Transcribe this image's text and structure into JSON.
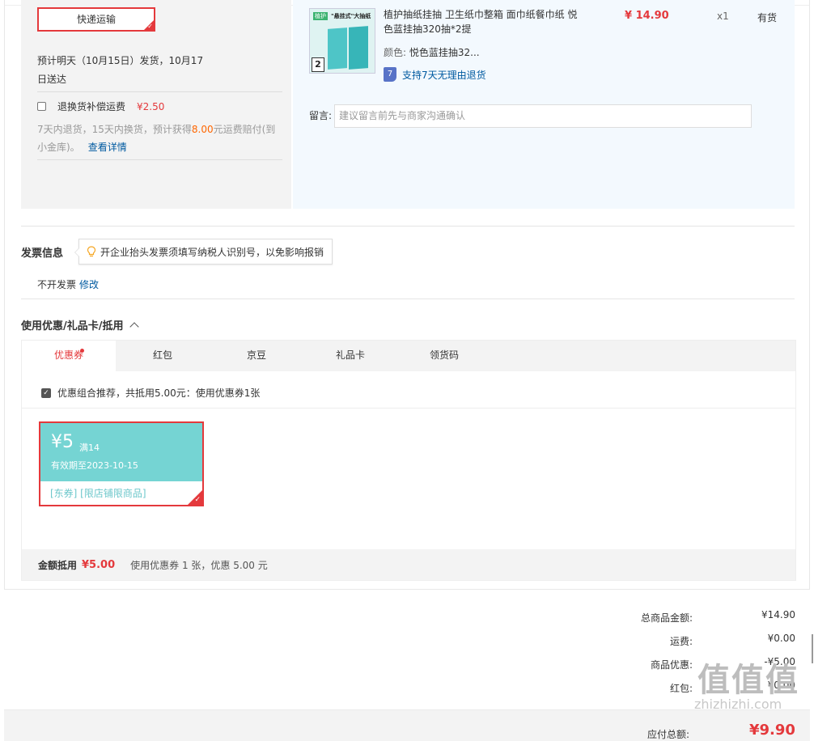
{
  "shipping": {
    "method_label": "快递运输",
    "eta": "预计明天（10月15日）发货，10月17日送达",
    "refund_label": "退换货补偿运费",
    "refund_price": "¥2.50",
    "refund_note_a": "7天内退货，15天内换货，预计获得",
    "refund_note_amount": "8.00",
    "refund_note_b": "元运费赔付(到小金库)。",
    "refund_link": "查看详情"
  },
  "product": {
    "title": "植护抽纸挂抽 卫生纸巾整箱 面巾纸餐巾纸 悦色蓝挂抽320抽*2提",
    "color_label": "颜色:",
    "color_value": "悦色蓝挂抽32...",
    "return_badge": "7",
    "return_text": "支持7天无理由退货",
    "price": "¥ 14.90",
    "qty": "x1",
    "stock": "有货",
    "image_tag": "植护",
    "image_head": "\"悬挂式\"大抽纸",
    "image_count": "2"
  },
  "message": {
    "label": "留言:",
    "placeholder": "建议留言前先与商家沟通确认"
  },
  "invoice": {
    "title": "发票信息",
    "tip": "开企业抬头发票须填写纳税人识别号，以免影响报销",
    "value": "不开发票",
    "edit_link": "修改"
  },
  "coupons": {
    "title": "使用优惠/礼品卡/抵用",
    "tabs": [
      "优惠券",
      "红包",
      "京豆",
      "礼品卡",
      "领货码"
    ],
    "combo_text": "优惠组合推荐，共抵用5.00元：使用优惠券1张",
    "card": {
      "amount": "¥5",
      "condition": "满14",
      "expiry": "有效期至2023-10-15",
      "tags": "[东券] [限店铺限商品]"
    },
    "summary_label": "金额抵用",
    "summary_amount": "¥5.00",
    "summary_note": "使用优惠券 1 张，优惠 5.00 元"
  },
  "totals": {
    "rows": [
      {
        "label": "总商品金额:",
        "value": "¥14.90"
      },
      {
        "label": "运费:",
        "value": "¥0.00"
      },
      {
        "label": "商品优惠:",
        "value": "-¥5.00"
      },
      {
        "label": "红包:",
        "value": "¥0.00"
      }
    ],
    "final_label": "应付总额:",
    "final_value": "¥9.90"
  },
  "watermark": {
    "logo": "值值值",
    "url": "zhizhizhi.com"
  },
  "colors": {
    "accent": "#e4393c",
    "link": "#005aa0",
    "coupon": "#75d4d3"
  }
}
